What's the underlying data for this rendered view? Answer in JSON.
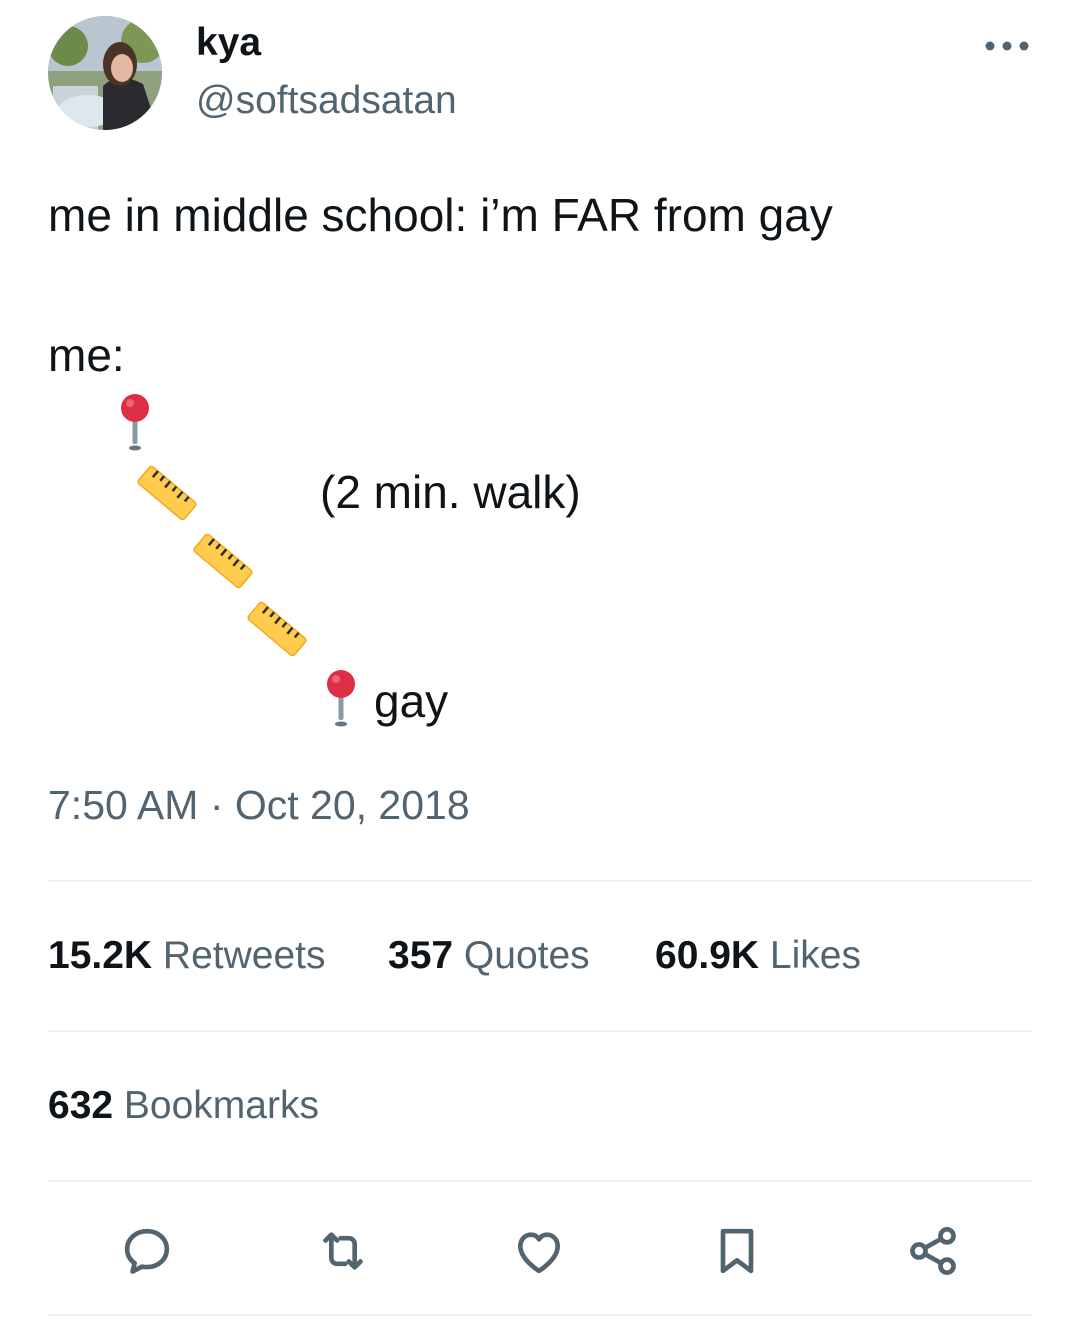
{
  "author": {
    "display_name": "kya",
    "handle": "@softsadsatan"
  },
  "tweet": {
    "line1": "me in middle school: i’m FAR from gay",
    "line2": "me:",
    "map_walk_label": "(2 min. walk)",
    "map_destination_label": "gay"
  },
  "timestamp": {
    "time": "7:50 AM",
    "separator": " · ",
    "date": "Oct 20, 2018"
  },
  "stats": {
    "retweets_count": "15.2K",
    "retweets_label": " Retweets",
    "quotes_count": "357",
    "quotes_label": " Quotes",
    "likes_count": "60.9K",
    "likes_label": " Likes",
    "bookmarks_count": "632",
    "bookmarks_label": " Bookmarks"
  },
  "icons": {
    "more": "more-horizontal-icon",
    "reply": "reply-icon",
    "retweet": "retweet-icon",
    "like": "heart-icon",
    "bookmark": "bookmark-icon",
    "share": "share-icon",
    "pin": "round-pushpin-emoji",
    "ruler": "straight-ruler-emoji"
  },
  "colors": {
    "text": "#0f1419",
    "secondary": "#536471",
    "divider": "#eff3f4",
    "pin": "#dd2e44",
    "ruler": "#ffcc4d"
  }
}
